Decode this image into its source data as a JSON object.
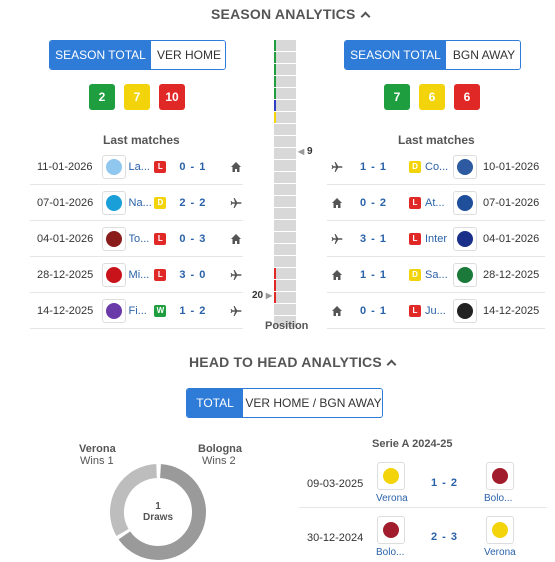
{
  "season_analytics": {
    "title": "SEASON ANALYTICS",
    "left": {
      "tabs": [
        "SEASON TOTAL",
        "VER HOME"
      ],
      "summary": [
        {
          "value": "2",
          "kind": "w"
        },
        {
          "value": "7",
          "kind": "d"
        },
        {
          "value": "10",
          "kind": "l"
        }
      ],
      "last_matches_title": "Last matches",
      "matches": [
        {
          "date": "11-01-2026",
          "team": "La...",
          "result": "L",
          "score": "0 - 1",
          "venue": "home-icon",
          "logo_color": "#8fc7ee"
        },
        {
          "date": "07-01-2026",
          "team": "Na...",
          "result": "D",
          "score": "2 - 2",
          "venue": "plane-icon",
          "logo_color": "#1a9fd9"
        },
        {
          "date": "04-01-2026",
          "team": "To...",
          "result": "L",
          "score": "0 - 3",
          "venue": "home-icon",
          "logo_color": "#8b1c1c"
        },
        {
          "date": "28-12-2025",
          "team": "Mi...",
          "result": "L",
          "score": "3 - 0",
          "venue": "plane-icon",
          "logo_color": "#c9131b"
        },
        {
          "date": "14-12-2025",
          "team": "Fi...",
          "result": "W",
          "score": "1 - 2",
          "venue": "plane-icon",
          "logo_color": "#6a3aa8"
        }
      ]
    },
    "right": {
      "tabs": [
        "SEASON TOTAL",
        "BGN AWAY"
      ],
      "summary": [
        {
          "value": "7",
          "kind": "w"
        },
        {
          "value": "6",
          "kind": "d"
        },
        {
          "value": "6",
          "kind": "l"
        }
      ],
      "last_matches_title": "Last matches",
      "matches": [
        {
          "date": "10-01-2026",
          "team": "Co...",
          "result": "D",
          "score": "1 - 1",
          "venue": "plane-icon",
          "logo_color": "#2d5aa0"
        },
        {
          "date": "07-01-2026",
          "team": "At...",
          "result": "L",
          "score": "0 - 2",
          "venue": "home-icon",
          "logo_color": "#1f4e9a"
        },
        {
          "date": "04-01-2026",
          "team": "Inter",
          "result": "L",
          "score": "3 - 1",
          "venue": "plane-icon",
          "logo_color": "#1a2f8a"
        },
        {
          "date": "28-12-2025",
          "team": "Sa...",
          "result": "D",
          "score": "1 - 1",
          "venue": "home-icon",
          "logo_color": "#1b7a3a"
        },
        {
          "date": "14-12-2025",
          "team": "Ju...",
          "result": "L",
          "score": "0 - 1",
          "venue": "home-icon",
          "logo_color": "#222222"
        }
      ]
    },
    "position": {
      "label": "Position",
      "marker_top": "9",
      "marker_bottom": "20",
      "cells": 24
    }
  },
  "h2h_analytics": {
    "title": "HEAD TO HEAD ANALYTICS",
    "tabs": [
      "TOTAL",
      "VER HOME / BGN AWAY"
    ],
    "home_team": "Verona",
    "home_wins": "Wins 1",
    "away_team": "Bologna",
    "away_wins": "Wins 2",
    "draws_value": "1",
    "draws_label": "Draws",
    "competition": "Serie A 2024-25",
    "matches": [
      {
        "date": "09-03-2025",
        "home": "Verona",
        "score": "1 - 2",
        "away": "Bolo...",
        "home_color": "#f3d40b",
        "away_color": "#a11c2c"
      },
      {
        "date": "30-12-2024",
        "home": "Bolo...",
        "score": "2 - 3",
        "away": "Verona",
        "home_color": "#a11c2c",
        "away_color": "#f3d40b"
      }
    ]
  },
  "colors": {
    "accent": "#2e7bd8",
    "win": "#1e9e3e",
    "draw": "#f3d40b",
    "loss": "#e02826"
  }
}
